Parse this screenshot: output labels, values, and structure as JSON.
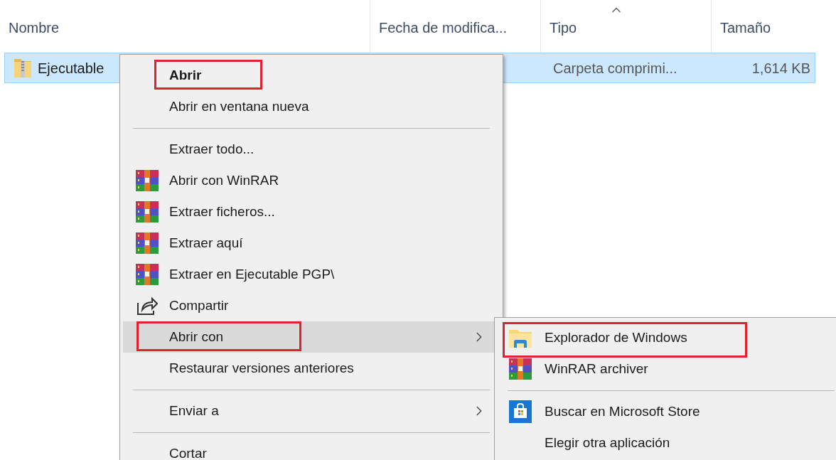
{
  "columns": [
    {
      "label": "Nombre",
      "sorted": false
    },
    {
      "label": "Fecha de modifica...",
      "sorted": false
    },
    {
      "label": "Tipo",
      "sorted": true
    },
    {
      "label": "Tamaño",
      "sorted": false
    }
  ],
  "file": {
    "name": "Ejecutable",
    "type": "Carpeta comprimi...",
    "size": "1,614 KB",
    "selected": true
  },
  "context_menu": [
    {
      "kind": "plain",
      "label": "Abrir",
      "bold": true,
      "hovered": false,
      "annotated": true,
      "submenu": false
    },
    {
      "kind": "plain",
      "label": "Abrir en ventana nueva",
      "bold": false,
      "hovered": false,
      "annotated": false,
      "submenu": false
    },
    {
      "kind": "separator"
    },
    {
      "kind": "plain",
      "label": "Extraer todo...",
      "bold": false,
      "hovered": false,
      "annotated": false,
      "submenu": false
    },
    {
      "kind": "winrar",
      "label": "Abrir con WinRAR",
      "bold": false,
      "hovered": false,
      "annotated": false,
      "submenu": false
    },
    {
      "kind": "winrar",
      "label": "Extraer ficheros...",
      "bold": false,
      "hovered": false,
      "annotated": false,
      "submenu": false
    },
    {
      "kind": "winrar",
      "label": "Extraer aquí",
      "bold": false,
      "hovered": false,
      "annotated": false,
      "submenu": false
    },
    {
      "kind": "winrar",
      "label": "Extraer en Ejecutable PGP\\",
      "bold": false,
      "hovered": false,
      "annotated": false,
      "submenu": false
    },
    {
      "kind": "share",
      "label": "Compartir",
      "bold": false,
      "hovered": false,
      "annotated": false,
      "submenu": false
    },
    {
      "kind": "plain",
      "label": "Abrir con",
      "bold": false,
      "hovered": true,
      "annotated": true,
      "submenu": true
    },
    {
      "kind": "plain",
      "label": "Restaurar versiones anteriores",
      "bold": false,
      "hovered": false,
      "annotated": false,
      "submenu": false
    },
    {
      "kind": "separator"
    },
    {
      "kind": "plain",
      "label": "Enviar a",
      "bold": false,
      "hovered": false,
      "annotated": false,
      "submenu": true
    },
    {
      "kind": "separator"
    },
    {
      "kind": "plain",
      "label": "Cortar",
      "bold": false,
      "hovered": false,
      "annotated": false,
      "submenu": false
    }
  ],
  "submenu": [
    {
      "kind": "folder",
      "label": "Explorador de Windows",
      "annotated": true
    },
    {
      "kind": "winrar",
      "label": "WinRAR archiver",
      "annotated": false
    },
    {
      "kind": "separator"
    },
    {
      "kind": "store",
      "label": "Buscar en Microsoft Store",
      "annotated": false
    },
    {
      "kind": "plain",
      "label": "Elegir otra aplicación",
      "annotated": false
    }
  ]
}
